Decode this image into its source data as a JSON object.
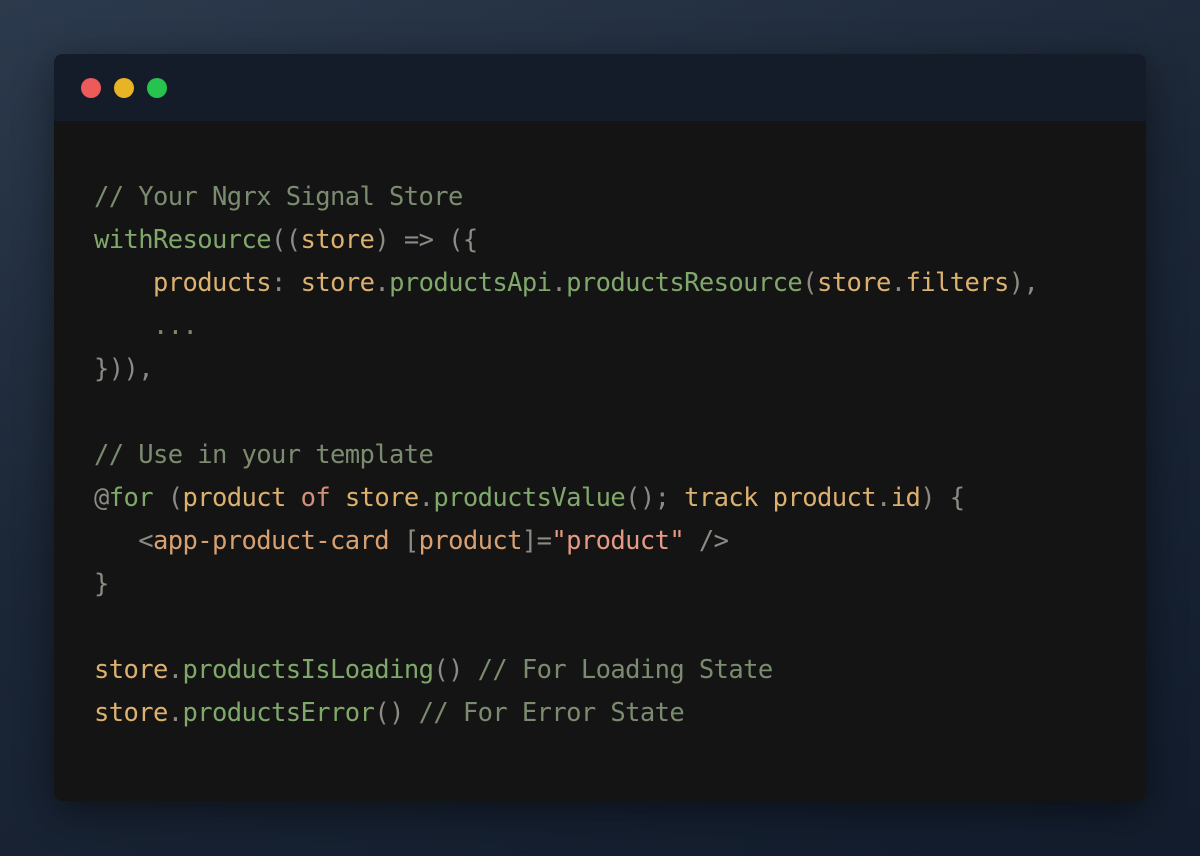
{
  "colors": {
    "comment": "#7b8b6f",
    "function": "#7fa86a",
    "variable": "#dcb06e",
    "plain": "#b9b4a8",
    "punctuation": "#8c8a83",
    "keyword": "#d4907a",
    "string": "#e59a83",
    "tag": "#d8a070",
    "dot_red": "#ec5a5a",
    "dot_yellow": "#e8b324",
    "dot_green": "#27c34f"
  },
  "window": {
    "buttons": [
      {
        "name": "close-dot",
        "color": "#ec5a5a"
      },
      {
        "name": "minimize-dot",
        "color": "#e8b324"
      },
      {
        "name": "maximize-dot",
        "color": "#27c34f"
      }
    ]
  },
  "code_lines": [
    [
      {
        "t": "// Your Ngrx Signal Store",
        "c": "comment"
      }
    ],
    [
      {
        "t": "withResource",
        "c": "function"
      },
      {
        "t": "((",
        "c": "punctuation"
      },
      {
        "t": "store",
        "c": "variable"
      },
      {
        "t": ") => ({",
        "c": "punctuation"
      }
    ],
    [
      {
        "t": "    ",
        "c": "plain"
      },
      {
        "t": "products",
        "c": "variable"
      },
      {
        "t": ": ",
        "c": "punctuation"
      },
      {
        "t": "store",
        "c": "variable"
      },
      {
        "t": ".",
        "c": "punctuation"
      },
      {
        "t": "productsApi",
        "c": "function"
      },
      {
        "t": ".",
        "c": "punctuation"
      },
      {
        "t": "productsResource",
        "c": "function"
      },
      {
        "t": "(",
        "c": "punctuation"
      },
      {
        "t": "store",
        "c": "variable"
      },
      {
        "t": ".",
        "c": "punctuation"
      },
      {
        "t": "filters",
        "c": "variable"
      },
      {
        "t": "),",
        "c": "punctuation"
      }
    ],
    [
      {
        "t": "    ...",
        "c": "comment"
      }
    ],
    [
      {
        "t": "})),",
        "c": "punctuation"
      }
    ],
    [],
    [
      {
        "t": "// Use in your template",
        "c": "comment"
      }
    ],
    [
      {
        "t": "@",
        "c": "punctuation"
      },
      {
        "t": "for",
        "c": "function"
      },
      {
        "t": " (",
        "c": "punctuation"
      },
      {
        "t": "product",
        "c": "variable"
      },
      {
        "t": " of ",
        "c": "keyword"
      },
      {
        "t": "store",
        "c": "variable"
      },
      {
        "t": ".",
        "c": "punctuation"
      },
      {
        "t": "productsValue",
        "c": "function"
      },
      {
        "t": "(); ",
        "c": "punctuation"
      },
      {
        "t": "track product",
        "c": "variable"
      },
      {
        "t": ".",
        "c": "punctuation"
      },
      {
        "t": "id",
        "c": "variable"
      },
      {
        "t": ") {",
        "c": "punctuation"
      }
    ],
    [
      {
        "t": "   <",
        "c": "punctuation"
      },
      {
        "t": "app-product-card",
        "c": "tag"
      },
      {
        "t": " [",
        "c": "punctuation"
      },
      {
        "t": "product",
        "c": "tag"
      },
      {
        "t": "]=",
        "c": "punctuation"
      },
      {
        "t": "\"product\"",
        "c": "string"
      },
      {
        "t": " />",
        "c": "punctuation"
      }
    ],
    [
      {
        "t": "}",
        "c": "punctuation"
      }
    ],
    [],
    [
      {
        "t": "store",
        "c": "variable"
      },
      {
        "t": ".",
        "c": "punctuation"
      },
      {
        "t": "productsIsLoading",
        "c": "function"
      },
      {
        "t": "() ",
        "c": "punctuation"
      },
      {
        "t": "// For Loading State",
        "c": "comment"
      }
    ],
    [
      {
        "t": "store",
        "c": "variable"
      },
      {
        "t": ".",
        "c": "punctuation"
      },
      {
        "t": "productsError",
        "c": "function"
      },
      {
        "t": "() ",
        "c": "punctuation"
      },
      {
        "t": "// For Error State",
        "c": "comment"
      }
    ]
  ]
}
